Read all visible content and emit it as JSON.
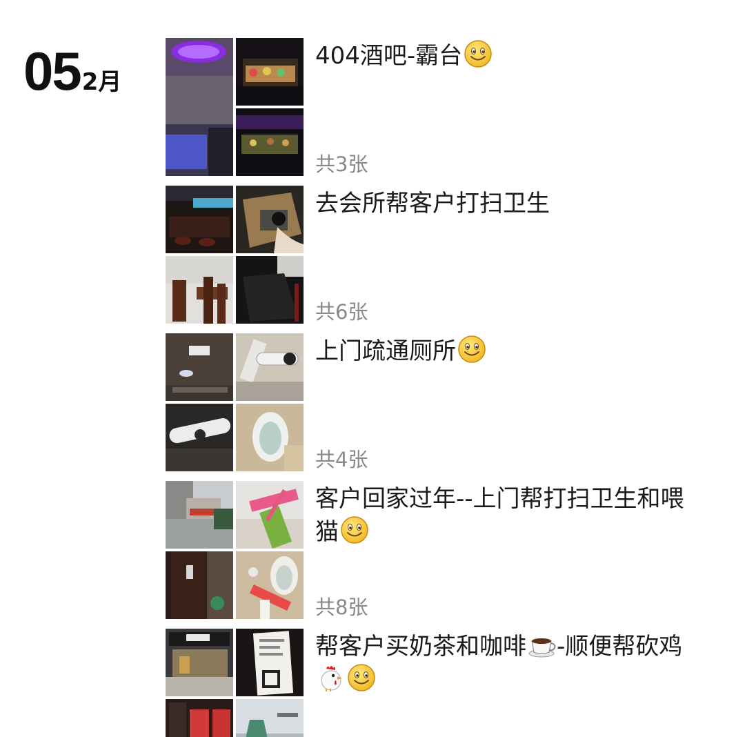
{
  "date": {
    "day": "05",
    "month": "2月"
  },
  "posts": [
    {
      "caption": "404酒吧-霸台",
      "count": "共3张"
    },
    {
      "caption": "去会所帮客户打扫卫生",
      "count": "共6张"
    },
    {
      "caption": "上门疏通厕所",
      "count": "共4张"
    },
    {
      "caption": "客户回家过年--上门帮打扫卫生和喂猫",
      "count": "共8张"
    },
    {
      "caption_a": "帮客户买奶茶和咖啡",
      "caption_b": "-顺便帮砍鸡"
    }
  ],
  "icons": [
    "smile-emoji-icon",
    "coffee-emoji-icon",
    "rooster-emoji-icon"
  ],
  "colors": {
    "text": "#1a1a1a",
    "muted": "#8a8a8a",
    "background": "#ffffff"
  }
}
